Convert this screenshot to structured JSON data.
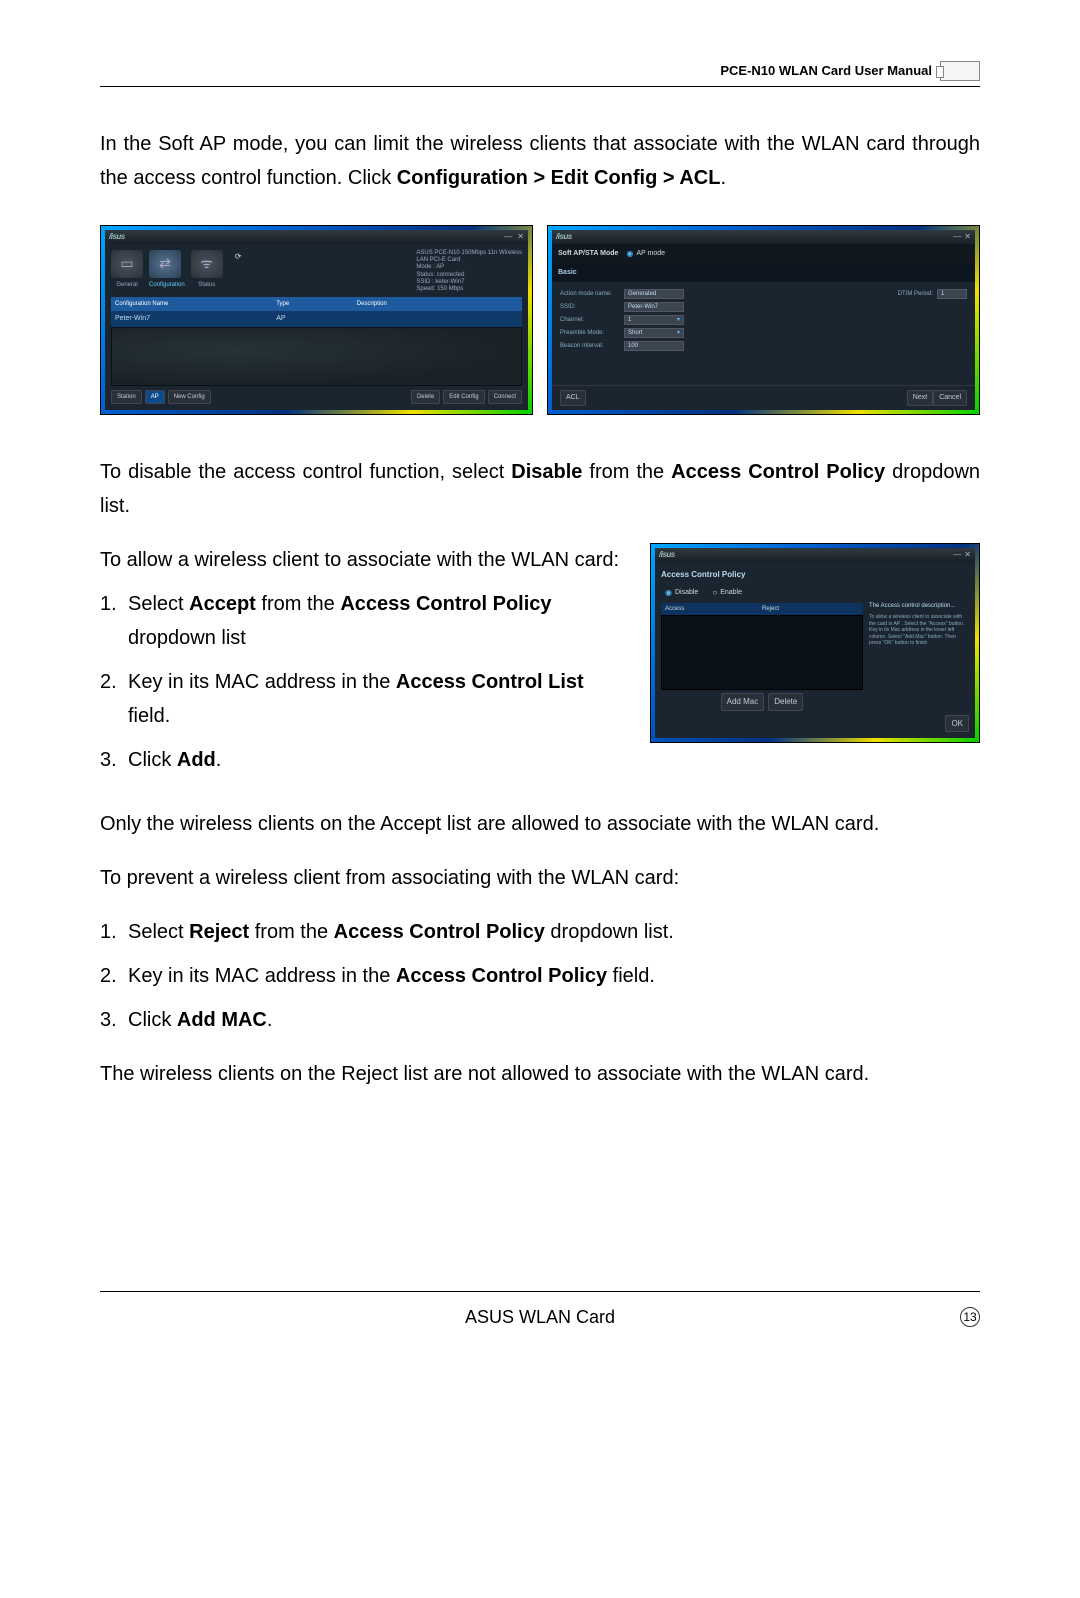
{
  "header": {
    "title": "PCE-N10 WLAN Card User Manual"
  },
  "intro": {
    "pre": "In the Soft AP mode, you can limit the wireless clients that associate with the WLAN card through the access control function. Click ",
    "bold": "Configuration > Edit Config > ACL",
    "post": "."
  },
  "ss1": {
    "logo": "/isus",
    "min": "—",
    "close": "✕",
    "tabs": {
      "general": "General",
      "config": "Configuration",
      "status": "Status"
    },
    "info": {
      "l1": "ASUS PCE-N10 150Mbps 11n Wireless",
      "l2": "LAN PCI-E Card",
      "l3": "Mode : AP",
      "l4": "Status: connected",
      "l5": "SSID : keter-Win7",
      "l6": "Speed: 150 Mbps"
    },
    "cols": {
      "c1": "Configuration Name",
      "c2": "Type",
      "c3": "Description"
    },
    "row": {
      "name": "Peter-Win7",
      "type": "AP"
    },
    "btns": {
      "station": "Station",
      "ap": "AP",
      "newconf": "New Config",
      "delete": "Delete",
      "editconf": "Edit Config",
      "connect": "Connect"
    }
  },
  "ss2": {
    "mode_label": "Soft AP/STA Mode",
    "mode_value": "AP mode",
    "basic": "Basic",
    "rows": {
      "action": {
        "label": "Action mode name:",
        "value": "Generated"
      },
      "dtim": {
        "label": "DTIM Period:",
        "value": "1"
      },
      "ssid": {
        "label": "SSID:",
        "value": "Peter-Win7"
      },
      "channel": {
        "label": "Channel:",
        "value": "1"
      },
      "preamble": {
        "label": "Preamble Mode:",
        "value": "Short"
      },
      "beacon": {
        "label": "Beacon Interval:",
        "value": "100"
      }
    },
    "acl": "ACL",
    "next": "Next",
    "cancel": "Cancel"
  },
  "disable": {
    "pre": "To disable the access control function, select ",
    "b1": "Disable",
    "mid": " from the ",
    "b2": "Access Control Policy",
    "post": " dropdown list."
  },
  "allow_intro": "To allow a wireless client to associate with the WLAN card:",
  "allow_steps": {
    "s1": {
      "num": "1.",
      "pre": "Select ",
      "b1": "Accept",
      "mid": " from the ",
      "b2": "Access Control Policy",
      "post": " dropdown list"
    },
    "s2": {
      "num": "2.",
      "pre": "Key in its MAC address in the ",
      "b1": "Access Control List",
      "post": " field."
    },
    "s3": {
      "num": "3.",
      "pre": "Click ",
      "b1": "Add",
      "post": "."
    }
  },
  "allow_after": "Only the wireless clients on the Accept list are allowed to associate with the WLAN card.",
  "ss3": {
    "title": "Access Control Policy",
    "disable": "Disable",
    "enable": "Enable",
    "col1": "Access",
    "col2": "Reject",
    "addmac": "Add Mac",
    "delete": "Delete",
    "ok": "OK",
    "desc_t": "The Access control description...",
    "desc_b": "To allow a wireless client to associate with the card in AP . Select the \"Access\" button. Key in its Mac address in the lower left column. Select \"Add Mac\" button. Then press \"OK\" button to finish"
  },
  "prevent_intro": "To prevent a wireless client from associating with the WLAN card:",
  "prevent_steps": {
    "s1": {
      "num": "1.",
      "pre": "Select ",
      "b1": "Reject",
      "mid": " from the ",
      "b2": "Access Control Policy",
      "post": " dropdown list."
    },
    "s2": {
      "num": "2.",
      "pre": "Key in its MAC address in the ",
      "b1": "Access Control Policy",
      "post": " field."
    },
    "s3": {
      "num": "3.",
      "pre": "Click ",
      "b1": "Add MAC",
      "post": "."
    }
  },
  "prevent_after": "The wireless clients on the Reject list are not allowed to associate with the WLAN card.",
  "footer": {
    "text": "ASUS WLAN Card",
    "page": "13"
  }
}
